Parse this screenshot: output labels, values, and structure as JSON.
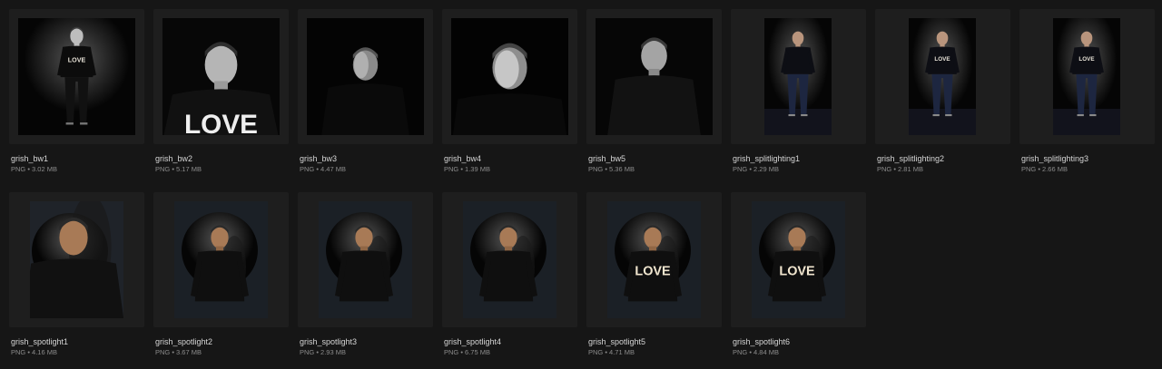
{
  "files": [
    {
      "name": "grish_bw1",
      "meta": "PNG • 3.02 MB",
      "style": "bw-full",
      "icon": "portrait-bw-full-body-image"
    },
    {
      "name": "grish_bw2",
      "meta": "PNG • 5.17 MB",
      "style": "bw-love",
      "icon": "portrait-bw-closeup-image"
    },
    {
      "name": "grish_bw3",
      "meta": "PNG • 4.47 MB",
      "style": "bw-dark",
      "icon": "portrait-bw-lowkey-image"
    },
    {
      "name": "grish_bw4",
      "meta": "PNG • 1.39 MB",
      "style": "bw-face",
      "icon": "portrait-bw-face-image"
    },
    {
      "name": "grish_bw5",
      "meta": "PNG • 5.36 MB",
      "style": "bw-mid",
      "icon": "portrait-bw-halfbody-image"
    },
    {
      "name": "grish_splitlighting1",
      "meta": "PNG • 2.29 MB",
      "style": "split",
      "icon": "portrait-split-lighting-image"
    },
    {
      "name": "grish_splitlighting2",
      "meta": "PNG • 2.81 MB",
      "style": "split-love",
      "icon": "portrait-split-lighting-image"
    },
    {
      "name": "grish_splitlighting3",
      "meta": "PNG • 2.66 MB",
      "style": "split-love",
      "icon": "portrait-split-lighting-image"
    },
    {
      "name": "grish_spotlight1",
      "meta": "PNG • 4.16 MB",
      "style": "spot-close",
      "icon": "portrait-spotlight-image"
    },
    {
      "name": "grish_spotlight2",
      "meta": "PNG • 3.67 MB",
      "style": "spot",
      "icon": "portrait-spotlight-image"
    },
    {
      "name": "grish_spotlight3",
      "meta": "PNG • 2.93 MB",
      "style": "spot",
      "icon": "portrait-spotlight-image"
    },
    {
      "name": "grish_spotlight4",
      "meta": "PNG • 6.75 MB",
      "style": "spot",
      "icon": "portrait-spotlight-image"
    },
    {
      "name": "grish_spotlight5",
      "meta": "PNG • 4.71 MB",
      "style": "spot-love",
      "icon": "portrait-spotlight-image"
    },
    {
      "name": "grish_spotlight6",
      "meta": "PNG • 4.84 MB",
      "style": "spot-love",
      "icon": "portrait-spotlight-image"
    }
  ],
  "thumbnail_text": {
    "shirt": "LOVE"
  },
  "colors": {
    "background": "#161616",
    "tile": "#1e1e1e",
    "name_text": "#d6d6d6",
    "meta_text": "#8c8c8c",
    "spot_glow": "#e0a565",
    "split_backdrop": "#1d2447"
  }
}
